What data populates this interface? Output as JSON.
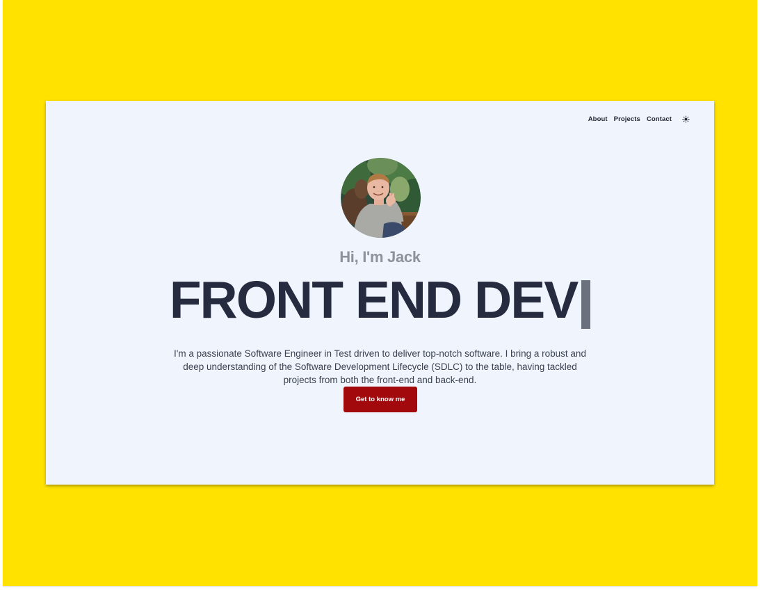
{
  "nav": {
    "items": [
      {
        "label": "About"
      },
      {
        "label": "Projects"
      },
      {
        "label": "Contact"
      }
    ],
    "theme_toggle_icon": "sun-icon"
  },
  "hero": {
    "avatar_icon": "profile-photo",
    "greeting": "Hi, I'm Jack",
    "headline": "FRONT END DEV",
    "description": "I'm a passionate Software Engineer in Test driven to deliver top-notch software. I bring a robust and deep understanding of the Software Development Lifecycle (SDLC) to the table, having tackled projects from both the front-end and back-end.",
    "cta_label": "Get to know me"
  },
  "colors": {
    "frame_background": "#ffe200",
    "page_background": "#f0f5fd",
    "headline": "#262b40",
    "greeting": "#8c919c",
    "cta_background": "#a1090c"
  }
}
